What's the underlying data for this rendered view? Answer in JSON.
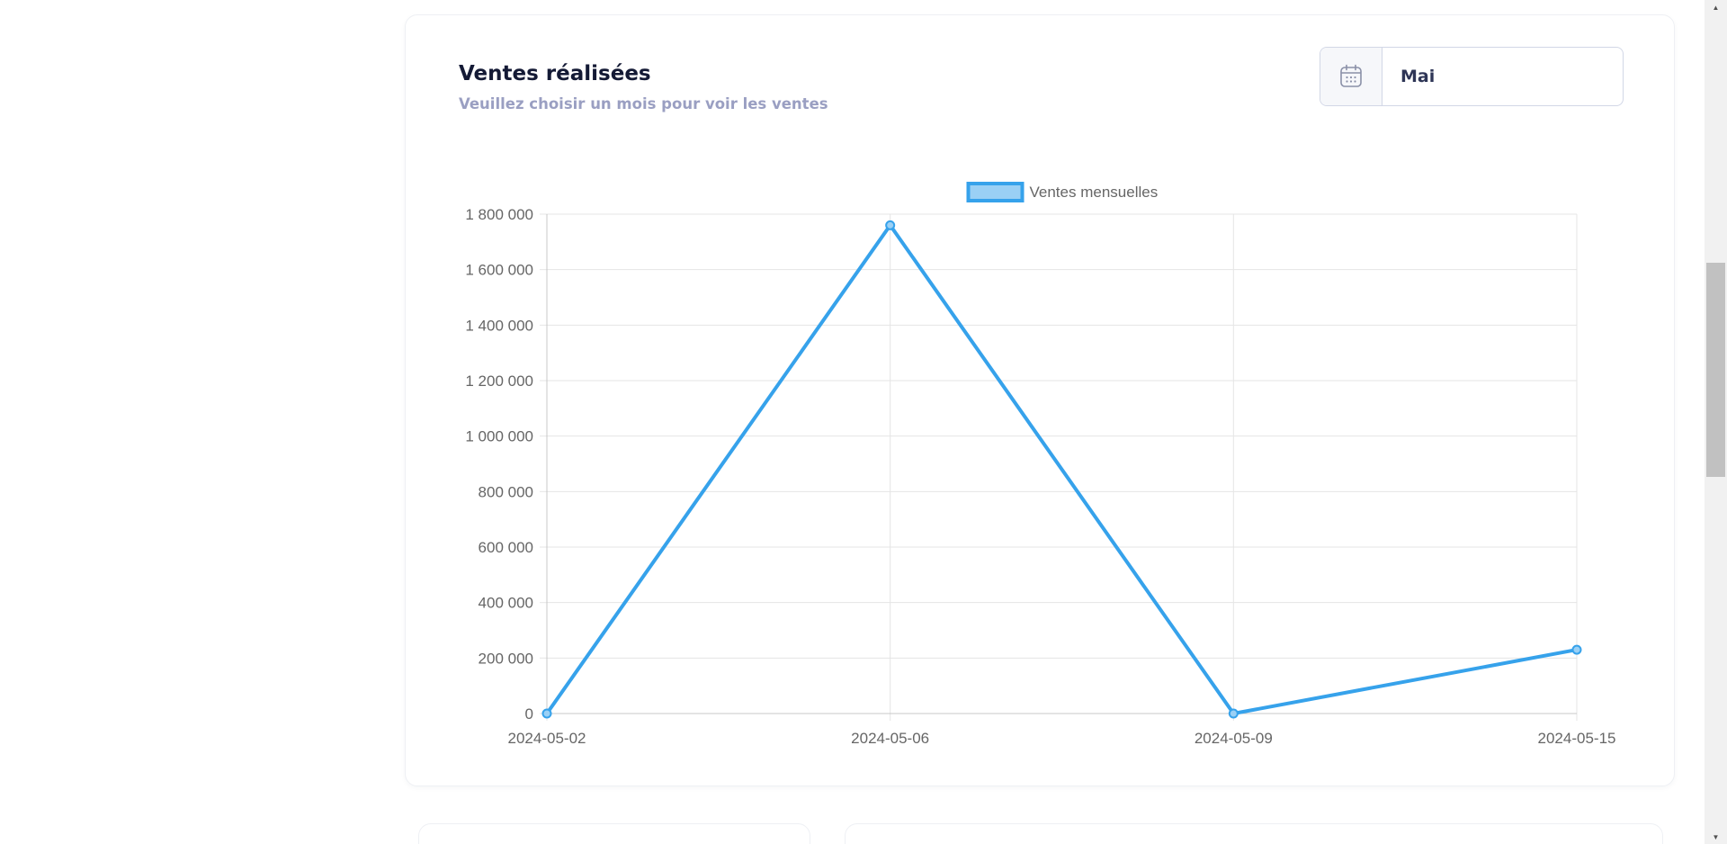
{
  "card": {
    "title": "Ventes réalisées",
    "subtitle": "Veuillez choisir un mois pour voir les ventes"
  },
  "month_picker": {
    "icon": "calendar-icon",
    "value": "Mai"
  },
  "chart_data": {
    "type": "line",
    "categories": [
      "2024-05-02",
      "2024-05-06",
      "2024-05-09",
      "2024-05-15"
    ],
    "series": [
      {
        "name": "Ventes mensuelles",
        "values": [
          0,
          1760000,
          0,
          230000
        ],
        "color": "#36a2eb",
        "fill": "#9ad0f5"
      }
    ],
    "y_ticks": [
      "0",
      "200 000",
      "400 000",
      "600 000",
      "800 000",
      "1 000 000",
      "1 200 000",
      "1 400 000",
      "1 600 000",
      "1 800 000"
    ],
    "ylim": [
      0,
      1800000
    ],
    "legend_position": "top",
    "grid": true
  },
  "colors": {
    "grid": "#e5e5e5",
    "tick_text": "#666666",
    "line": "#36a2eb"
  }
}
